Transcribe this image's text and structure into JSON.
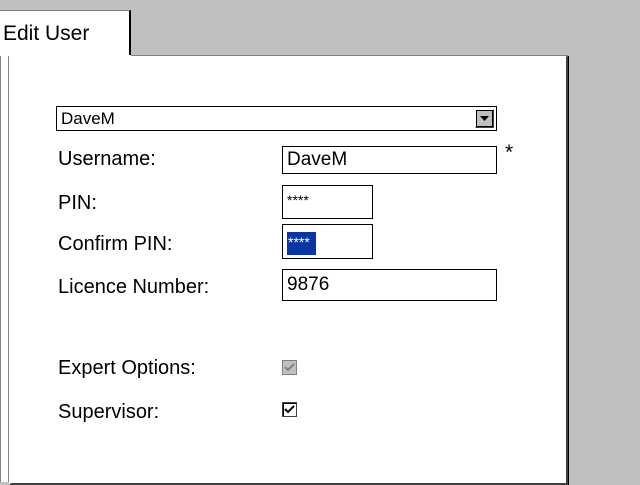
{
  "tab": {
    "label": "Edit User"
  },
  "user_select": {
    "value": "DaveM"
  },
  "form": {
    "username_label": "Username:",
    "username_value": "DaveM",
    "required_marker": "*",
    "pin_label": "PIN:",
    "pin_value": "****",
    "confirm_pin_label": "Confirm PIN:",
    "confirm_pin_value": "****",
    "licence_label": "Licence Number:",
    "licence_value": "9876",
    "expert_options_label": "Expert Options:",
    "expert_options_checked": true,
    "expert_options_enabled": false,
    "supervisor_label": "Supervisor:",
    "supervisor_checked": true
  },
  "icons": {
    "combo_arrow": "chevron-down-icon",
    "checkmark": "checkmark-icon"
  },
  "colors": {
    "background": "#c0c0c0",
    "panel": "#ffffff",
    "selection": "#0a36a5"
  }
}
